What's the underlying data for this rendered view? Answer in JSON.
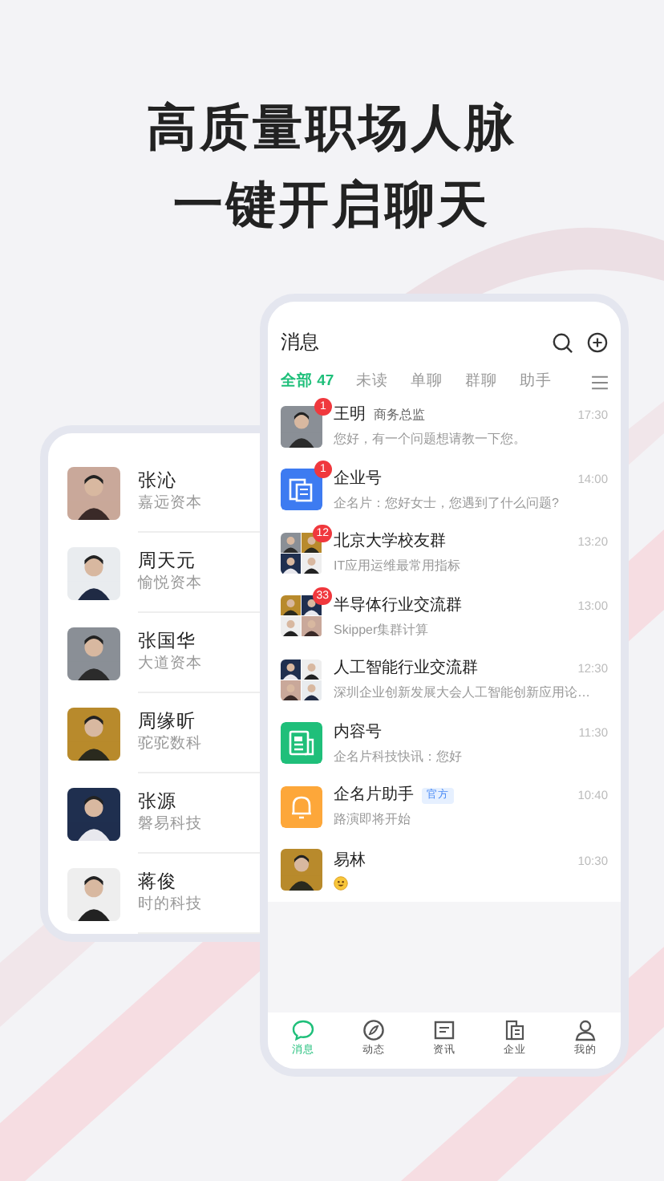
{
  "headline": [
    "高质量职场人脉",
    "一键开启聊天"
  ],
  "contacts": [
    {
      "name": "张沁",
      "company": "嘉远资本"
    },
    {
      "name": "周天元",
      "company": "愉悦资本"
    },
    {
      "name": "张国华",
      "company": "大道资本"
    },
    {
      "name": "周缘昕",
      "company": "驼驼数科"
    },
    {
      "name": "张源",
      "company": "磐易科技"
    },
    {
      "name": "蒋俊",
      "company": "时的科技"
    }
  ],
  "header": {
    "title": "消息"
  },
  "tabs": [
    {
      "label": "全部 47",
      "selected": true
    },
    {
      "label": "未读",
      "selected": false
    },
    {
      "label": "单聊",
      "selected": false
    },
    {
      "label": "群聊",
      "selected": false
    },
    {
      "label": "助手",
      "selected": false
    }
  ],
  "chats": [
    {
      "kind": "person",
      "name": "王明",
      "subtitle": "商务总监",
      "message": "您好，有一个问题想请教一下您。",
      "time": "17:30",
      "badge": "1"
    },
    {
      "kind": "enterprise",
      "name": "企业号",
      "message": "企名片：您好女士，您遇到了什么问题?",
      "time": "14:00",
      "badge": "1"
    },
    {
      "kind": "group",
      "name": "北京大学校友群",
      "message": "IT应用运维最常用指标",
      "time": "13:20",
      "badge": "12"
    },
    {
      "kind": "group",
      "name": "半导体行业交流群",
      "message": "Skipper集群计算",
      "time": "13:00",
      "badge": "33"
    },
    {
      "kind": "group",
      "name": "人工智能行业交流群",
      "message": "深圳企业创新发展大会人工智能创新应用论…",
      "time": "12:30"
    },
    {
      "kind": "content",
      "name": "内容号",
      "message": "企名片科技快讯：您好",
      "time": "11:30"
    },
    {
      "kind": "assistant",
      "name": "企名片助手",
      "tag": "官方",
      "message": "路演即将开始",
      "time": "10:40"
    },
    {
      "kind": "person",
      "name": "易林",
      "time": "10:30"
    }
  ],
  "nav": [
    {
      "label": "消息",
      "selected": true
    },
    {
      "label": "动态",
      "selected": false
    },
    {
      "label": "资讯",
      "selected": false
    },
    {
      "label": "企业",
      "selected": false
    },
    {
      "label": "我的",
      "selected": false
    }
  ]
}
